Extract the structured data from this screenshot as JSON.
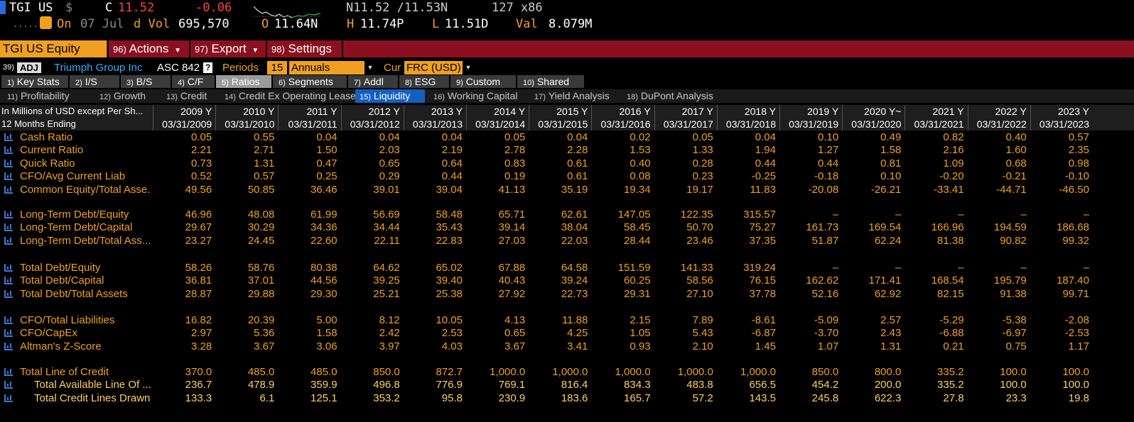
{
  "quote": {
    "ticker": "TGI US",
    "currency_symbol": "$",
    "close_label": "C",
    "close_value": "11.52",
    "change": "-0.06",
    "bid_ask": "N11.52 /11.53N",
    "size": "127 x86",
    "on_label": "On",
    "date": "07 Jul",
    "vol_label": "d Vol",
    "volume": "695,570",
    "open_label": "O",
    "open_value": "11.64N",
    "high_label": "H",
    "high_value": "11.74P",
    "low_label": "L",
    "low_value": "11.51D",
    "val_label": "Val",
    "val_value": "8.079M"
  },
  "menu": {
    "security": "TGI US Equity",
    "actions_num": "96)",
    "actions": "Actions",
    "export_num": "97)",
    "export": "Export",
    "settings_num": "98)",
    "settings": "Settings"
  },
  "options": {
    "num": "39)",
    "adj": "ADJ",
    "company": "Triumph Group Inc",
    "asc": "ASC 842",
    "help": "?",
    "periods_label": "Periods",
    "periods_value": "15",
    "period_type": "Annuals",
    "cur_label": "Cur",
    "cur_value": "FRC (USD)"
  },
  "tabs": [
    {
      "num": "1)",
      "label": "Key Stats"
    },
    {
      "num": "2)",
      "label": "I/S"
    },
    {
      "num": "3)",
      "label": "B/S"
    },
    {
      "num": "4)",
      "label": "C/F"
    },
    {
      "num": "5)",
      "label": "Ratios"
    },
    {
      "num": "6)",
      "label": "Segments"
    },
    {
      "num": "7)",
      "label": "Addl"
    },
    {
      "num": "8)",
      "label": "ESG"
    },
    {
      "num": "9)",
      "label": "Custom"
    },
    {
      "num": "10)",
      "label": "Shared"
    }
  ],
  "subtabs": [
    {
      "num": "11)",
      "label": "Profitability"
    },
    {
      "num": "12)",
      "label": "Growth"
    },
    {
      "num": "13)",
      "label": "Credit"
    },
    {
      "num": "14)",
      "label": "Credit Ex Operating Leases"
    },
    {
      "num": "15)",
      "label": "Liquidity"
    },
    {
      "num": "16)",
      "label": "Working Capital"
    },
    {
      "num": "17)",
      "label": "Yield Analysis"
    },
    {
      "num": "18)",
      "label": "DuPont Analysis"
    }
  ],
  "table": {
    "header_label": "In Millions of USD except Per Sh...",
    "period_label": "12 Months Ending",
    "years": [
      "2009 Y",
      "2010 Y",
      "2011 Y",
      "2012 Y",
      "2013 Y",
      "2014 Y",
      "2015 Y",
      "2016 Y",
      "2017 Y",
      "2018 Y",
      "2019 Y",
      "2020 Y~",
      "2021 Y",
      "2022 Y",
      "2023 Y"
    ],
    "dates": [
      "03/31/2009",
      "03/31/2010",
      "03/31/2011",
      "03/31/2012",
      "03/31/2013",
      "03/31/2014",
      "03/31/2015",
      "03/31/2016",
      "03/31/2017",
      "03/31/2018",
      "03/31/2019",
      "03/31/2020",
      "03/31/2021",
      "03/31/2022",
      "03/31/2023"
    ],
    "rows": [
      {
        "label": "Cash Ratio",
        "values": [
          "0.05",
          "0.55",
          "0.04",
          "0.04",
          "0.04",
          "0.05",
          "0.04",
          "0.02",
          "0.05",
          "0.04",
          "0.10",
          "0.49",
          "0.82",
          "0.40",
          "0.57"
        ]
      },
      {
        "label": "Current Ratio",
        "values": [
          "2.21",
          "2.71",
          "1.50",
          "2.03",
          "2.19",
          "2.78",
          "2.28",
          "1.53",
          "1.33",
          "1.94",
          "1.27",
          "1.58",
          "2.16",
          "1.60",
          "2.35"
        ]
      },
      {
        "label": "Quick Ratio",
        "values": [
          "0.73",
          "1.31",
          "0.47",
          "0.65",
          "0.64",
          "0.83",
          "0.61",
          "0.40",
          "0.28",
          "0.44",
          "0.44",
          "0.81",
          "1.09",
          "0.68",
          "0.98"
        ]
      },
      {
        "label": "CFO/Avg Current Liab",
        "values": [
          "0.52",
          "0.57",
          "0.25",
          "0.29",
          "0.44",
          "0.19",
          "0.61",
          "0.08",
          "0.23",
          "-0.25",
          "-0.18",
          "0.10",
          "-0.20",
          "-0.21",
          "-0.10"
        ]
      },
      {
        "label": "Common Equity/Total Asse...",
        "values": [
          "49.56",
          "50.85",
          "36.46",
          "39.01",
          "39.04",
          "41.13",
          "35.19",
          "19.34",
          "19.17",
          "11.83",
          "-20.08",
          "-26.21",
          "-33.41",
          "-44.71",
          "-46.50"
        ]
      },
      {
        "label": "Long-Term Debt/Equity",
        "values": [
          "46.96",
          "48.08",
          "61.99",
          "56.69",
          "58.48",
          "65.71",
          "62.61",
          "147.05",
          "122.35",
          "315.57",
          "–",
          "–",
          "–",
          "–",
          "–"
        ]
      },
      {
        "label": "Long-Term Debt/Capital",
        "values": [
          "29.67",
          "30.29",
          "34.36",
          "34.44",
          "35.43",
          "39.14",
          "38.04",
          "58.45",
          "50.70",
          "75.27",
          "161.73",
          "169.54",
          "166.96",
          "194.59",
          "186.68"
        ]
      },
      {
        "label": "Long-Term Debt/Total Ass...",
        "values": [
          "23.27",
          "24.45",
          "22.60",
          "22.11",
          "22.83",
          "27.03",
          "22.03",
          "28.44",
          "23.46",
          "37.35",
          "51.87",
          "62.24",
          "81.38",
          "90.82",
          "99.32"
        ]
      },
      {
        "label": "Total Debt/Equity",
        "values": [
          "58.26",
          "58.76",
          "80.38",
          "64.62",
          "65.02",
          "67.88",
          "64.58",
          "151.59",
          "141.33",
          "319.24",
          "–",
          "–",
          "–",
          "–",
          "–"
        ]
      },
      {
        "label": "Total Debt/Capital",
        "values": [
          "36.81",
          "37.01",
          "44.56",
          "39.25",
          "39.40",
          "40.43",
          "39.24",
          "60.25",
          "58.56",
          "76.15",
          "162.62",
          "171.41",
          "168.54",
          "195.79",
          "187.40"
        ]
      },
      {
        "label": "Total Debt/Total Assets",
        "values": [
          "28.87",
          "29.88",
          "29.30",
          "25.21",
          "25.38",
          "27.92",
          "22.73",
          "29.31",
          "27.10",
          "37.78",
          "52.16",
          "62.92",
          "82.15",
          "91.38",
          "99.71"
        ]
      },
      {
        "label": "CFO/Total Liabilities",
        "values": [
          "16.82",
          "20.39",
          "5.00",
          "8.12",
          "10.05",
          "4.13",
          "11.88",
          "2.15",
          "7.89",
          "-8.61",
          "-5.09",
          "2.57",
          "-5.29",
          "-5.38",
          "-2.08"
        ]
      },
      {
        "label": "CFO/CapEx",
        "values": [
          "2.97",
          "5.36",
          "1.58",
          "2.42",
          "2.53",
          "0.65",
          "4.25",
          "1.05",
          "5.43",
          "-6.87",
          "-3.70",
          "2.43",
          "-6.88",
          "-6.97",
          "-2.53"
        ]
      },
      {
        "label": "Altman's Z-Score",
        "values": [
          "3.28",
          "3.67",
          "3.06",
          "3.97",
          "4.03",
          "3.67",
          "3.41",
          "0.93",
          "2.10",
          "1.45",
          "1.07",
          "1.31",
          "0.21",
          "0.75",
          "1.17"
        ]
      },
      {
        "label": "Total Line of Credit",
        "values": [
          "370.0",
          "485.0",
          "485.0",
          "850.0",
          "872.7",
          "1,000.0",
          "1,000.0",
          "1,000.0",
          "1,000.0",
          "1,000.0",
          "850.0",
          "800.0",
          "335.2",
          "100.0",
          "100.0"
        ]
      },
      {
        "label": "Total Available Line Of ...",
        "sub": true,
        "values": [
          "236.7",
          "478.9",
          "359.9",
          "496.8",
          "776.9",
          "769.1",
          "816.4",
          "834.3",
          "483.8",
          "656.5",
          "454.2",
          "200.0",
          "335.2",
          "100.0",
          "100.0"
        ]
      },
      {
        "label": "Total Credit Lines Drawn",
        "sub": true,
        "values": [
          "133.3",
          "6.1",
          "125.1",
          "353.2",
          "95.8",
          "230.9",
          "183.6",
          "165.7",
          "57.2",
          "143.5",
          "245.8",
          "622.3",
          "27.8",
          "23.3",
          "19.8"
        ]
      }
    ]
  },
  "colors": {
    "orange": "#f0a020",
    "yellow": "#ffd060",
    "menu_red": "#8a1020",
    "tab_blue": "#1460c0"
  }
}
